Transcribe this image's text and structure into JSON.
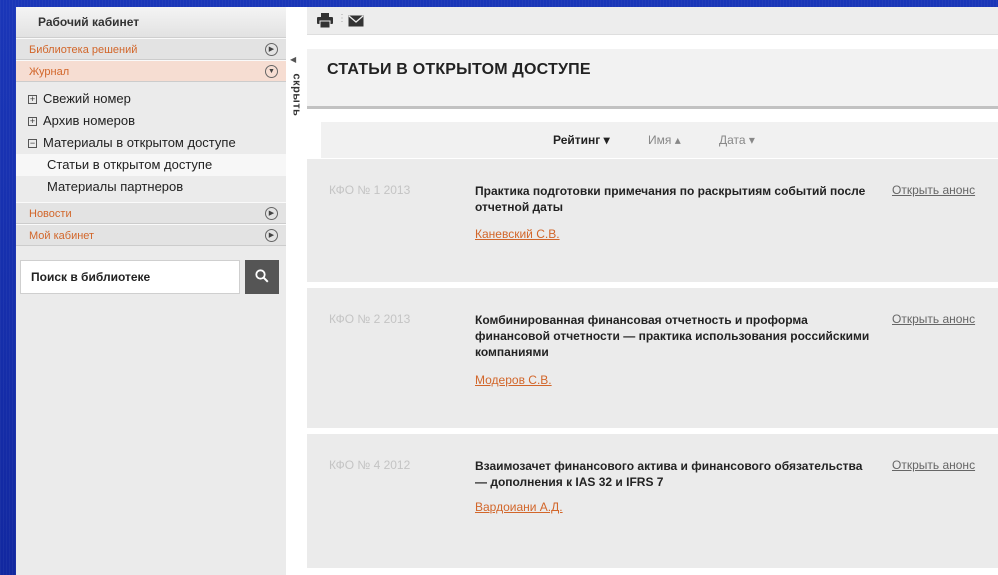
{
  "sidebar": {
    "title": "Рабочий кабинет",
    "sections": [
      {
        "label": "Библиотека решений"
      },
      {
        "label": "Журнал"
      },
      {
        "label": "Новости"
      },
      {
        "label": "Мой кабинет"
      }
    ],
    "journal_items": [
      {
        "label": "Свежий номер",
        "prefix": "+"
      },
      {
        "label": "Архив номеров",
        "prefix": "+"
      },
      {
        "label": "Материалы в открытом доступе",
        "prefix": "−"
      }
    ],
    "journal_subitems": [
      {
        "label": "Статьи в открытом доступе"
      },
      {
        "label": "Материалы партнеров"
      }
    ],
    "search_placeholder": "Поиск в библиотеке",
    "collapse_label": "скрыть"
  },
  "main": {
    "page_title": "СТАТЬИ В ОТКРЫТОМ ДОСТУПЕ",
    "sort": {
      "rating": "Рейтинг ▾",
      "name": "Имя ▴",
      "date": "Дата ▾"
    },
    "articles": [
      {
        "issue": "КФО № 1 2013",
        "title": "Практика подготовки примечания по раскрытиям событий после отчетной даты",
        "author": "Каневский С.В.",
        "link": "Открыть анонс"
      },
      {
        "issue": "КФО № 2 2013",
        "title": "Комбинированная финансовая отчетность и проформа финансовой отчетности — практика использования российскими компаниями",
        "author": "Модеров С.В.",
        "link": "Открыть анонс"
      },
      {
        "issue": "КФО № 4 2012",
        "title": "Взаимозачет финансового актива и финансового обязательства — дополнения к IAS 32 и IFRS 7",
        "author": "Вардоиани А.Д.",
        "link": "Открыть анонс"
      }
    ]
  },
  "colors": {
    "accent": "#d2662a",
    "background": "#1530a8"
  },
  "icons": [
    "print-icon",
    "mail-icon",
    "search-icon",
    "circle-arrow-right-icon",
    "circle-arrow-down-icon"
  ]
}
